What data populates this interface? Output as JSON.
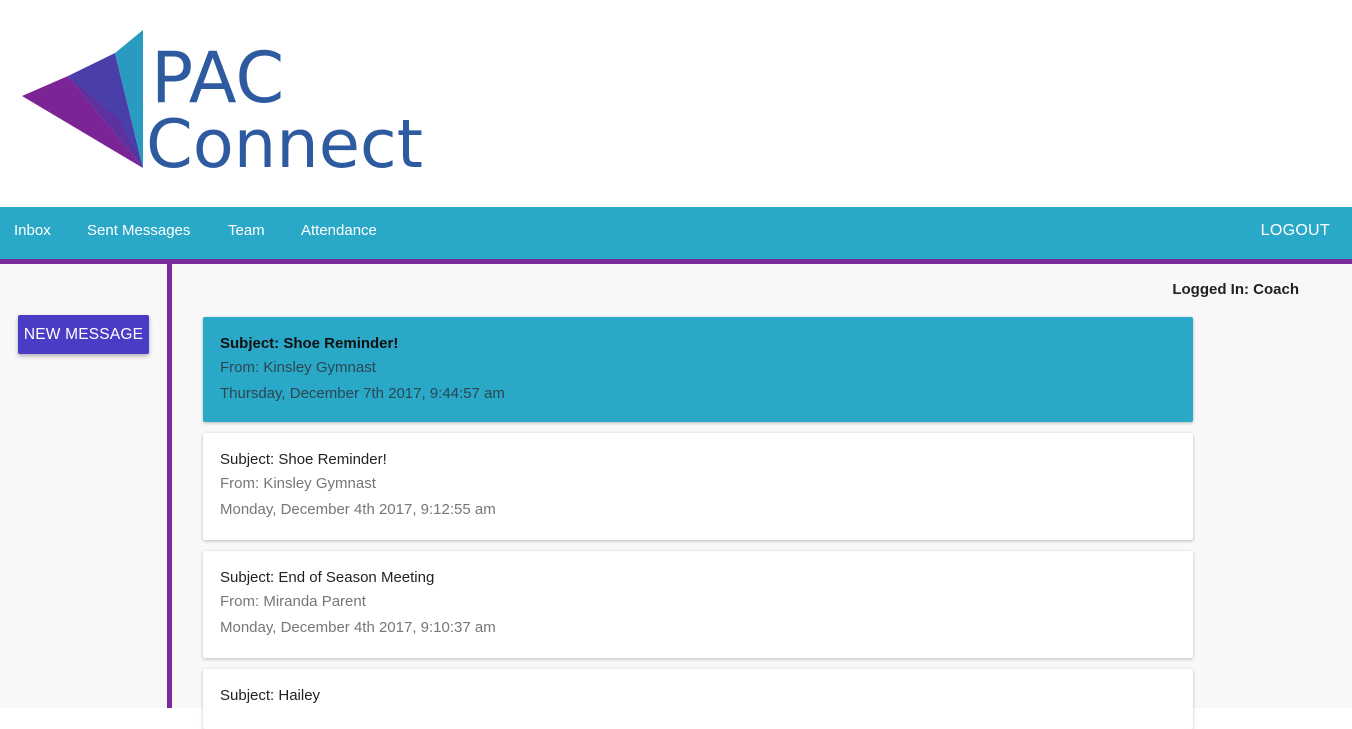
{
  "logo": {
    "line1": "PAC",
    "line2": "Connect",
    "colors": {
      "text": "#2e5aa0",
      "triangle_top": "#2a9bc0",
      "triangle_mid": "#4a3ea8",
      "triangle_bottom": "#7b2496"
    }
  },
  "nav": {
    "items": [
      {
        "label": "Inbox"
      },
      {
        "label": "Sent Messages"
      },
      {
        "label": "Team"
      },
      {
        "label": "Attendance"
      }
    ],
    "logout_label": "LOGOUT",
    "colors": {
      "bar": "#2aa8c8",
      "accent": "#7b2a9e"
    }
  },
  "sidebar": {
    "new_message_label": "NEW MESSAGE"
  },
  "status": {
    "logged_in": "Logged In: Coach"
  },
  "messages": [
    {
      "subject": "Subject: Shoe Reminder!",
      "from": "From: Kinsley Gymnast",
      "date": "Thursday, December 7th 2017, 9:44:57 am",
      "selected": true
    },
    {
      "subject": "Subject: Shoe Reminder!",
      "from": "From: Kinsley Gymnast",
      "date": "Monday, December 4th 2017, 9:12:55 am",
      "selected": false
    },
    {
      "subject": "Subject: End of Season Meeting",
      "from": "From: Miranda Parent",
      "date": "Monday, December 4th 2017, 9:10:37 am",
      "selected": false
    },
    {
      "subject": "Subject: Hailey",
      "from": "",
      "date": "",
      "selected": false
    }
  ]
}
